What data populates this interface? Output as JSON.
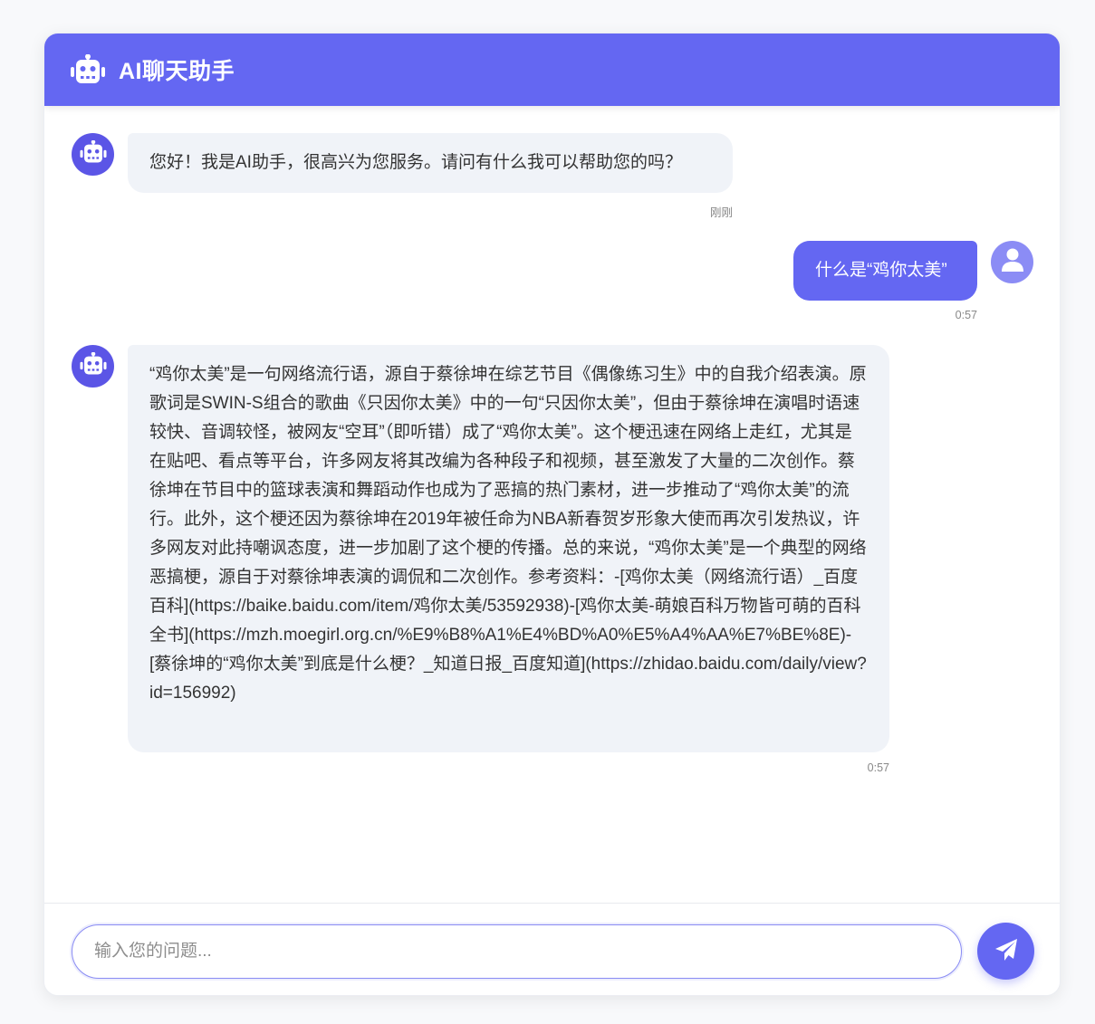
{
  "header": {
    "title": "AI聊天助手",
    "icon": "robot-icon"
  },
  "colors": {
    "accent": "#6467f2",
    "bot_avatar": "#5b55e6",
    "user_avatar": "#8b8cf5",
    "bot_bubble": "#f0f3f8"
  },
  "messages": [
    {
      "role": "bot",
      "text": "您好！我是AI助手，很高兴为您服务。请问有什么我可以帮助您的吗？",
      "time": "刚刚"
    },
    {
      "role": "user",
      "text": "什么是“鸡你太美”",
      "time": "0:57"
    },
    {
      "role": "bot",
      "text": "“鸡你太美”是一句网络流行语，源自于蔡徐坤在综艺节目《偶像练习生》中的自我介绍表演。原歌词是SWIN-S组合的歌曲《只因你太美》中的一句“只因你太美”，但由于蔡徐坤在演唱时语速较快、音调较怪，被网友“空耳”（即听错）成了“鸡你太美”。这个梗迅速在网络上走红，尤其是在贴吧、看点等平台，许多网友将其改编为各种段子和视频，甚至激发了大量的二次创作。蔡徐坤在节目中的篮球表演和舞蹈动作也成为了恶搞的热门素材，进一步推动了“鸡你太美”的流行。此外，这个梗还因为蔡徐坤在2019年被任命为NBA新春贺岁形象大使而再次引发热议，许多网友对此持嘲讽态度，进一步加剧了这个梗的传播。总的来说，“鸡你太美”是一个典型的网络恶搞梗，源自于对蔡徐坤表演的调侃和二次创作。参考资料：-[鸡你太美（网络流行语）_百度百科](https://baike.baidu.com/item/鸡你太美/53592938)-[鸡你太美-萌娘百科万物皆可萌的百科全书](https://mzh.moegirl.org.cn/%E9%B8%A1%E4%BD%A0%E5%A4%AA%E7%BE%8E)-[蔡徐坤的“鸡你太美”到底是什么梗？_知道日报_百度知道](https://zhidao.baidu.com/daily/view?id=156992)",
      "time": "0:57"
    }
  ],
  "input": {
    "placeholder": "输入您的问题...",
    "value": ""
  },
  "send_button": {
    "icon": "paper-plane-icon"
  }
}
